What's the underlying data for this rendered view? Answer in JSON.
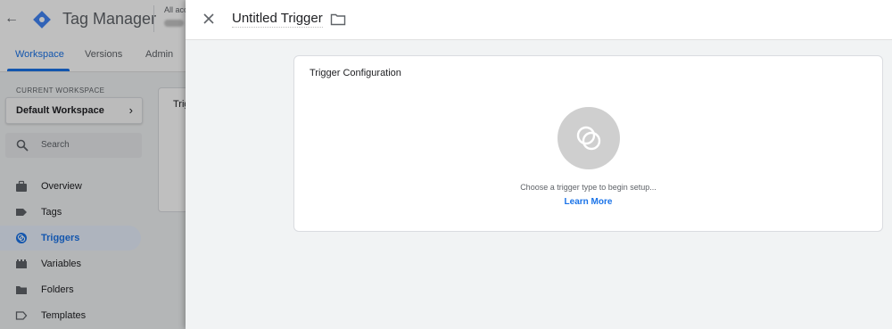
{
  "app": {
    "product_name": "Tag Manager",
    "account_label": "All acc",
    "colors": {
      "accent": "#1a73e8",
      "logo_blue": "#4285f4",
      "logo_dark": "#1967d2"
    }
  },
  "nav": {
    "tabs": [
      {
        "label": "Workspace",
        "active": true
      },
      {
        "label": "Versions",
        "active": false
      },
      {
        "label": "Admin",
        "active": false
      }
    ]
  },
  "sidebar": {
    "current_workspace_label": "CURRENT WORKSPACE",
    "workspace_name": "Default Workspace",
    "search_placeholder": "Search",
    "items": [
      {
        "label": "Overview",
        "icon": "briefcase-icon",
        "active": false
      },
      {
        "label": "Tags",
        "icon": "tag-icon",
        "active": false
      },
      {
        "label": "Triggers",
        "icon": "trigger-icon",
        "active": true
      },
      {
        "label": "Variables",
        "icon": "variables-icon",
        "active": false
      },
      {
        "label": "Folders",
        "icon": "folder-icon",
        "active": false
      },
      {
        "label": "Templates",
        "icon": "template-icon",
        "active": false
      }
    ]
  },
  "background_card": {
    "title": "Trig"
  },
  "panel": {
    "title": "Untitled Trigger",
    "config_title": "Trigger Configuration",
    "hint": "Choose a trigger type to begin setup...",
    "learn_more": "Learn More"
  }
}
